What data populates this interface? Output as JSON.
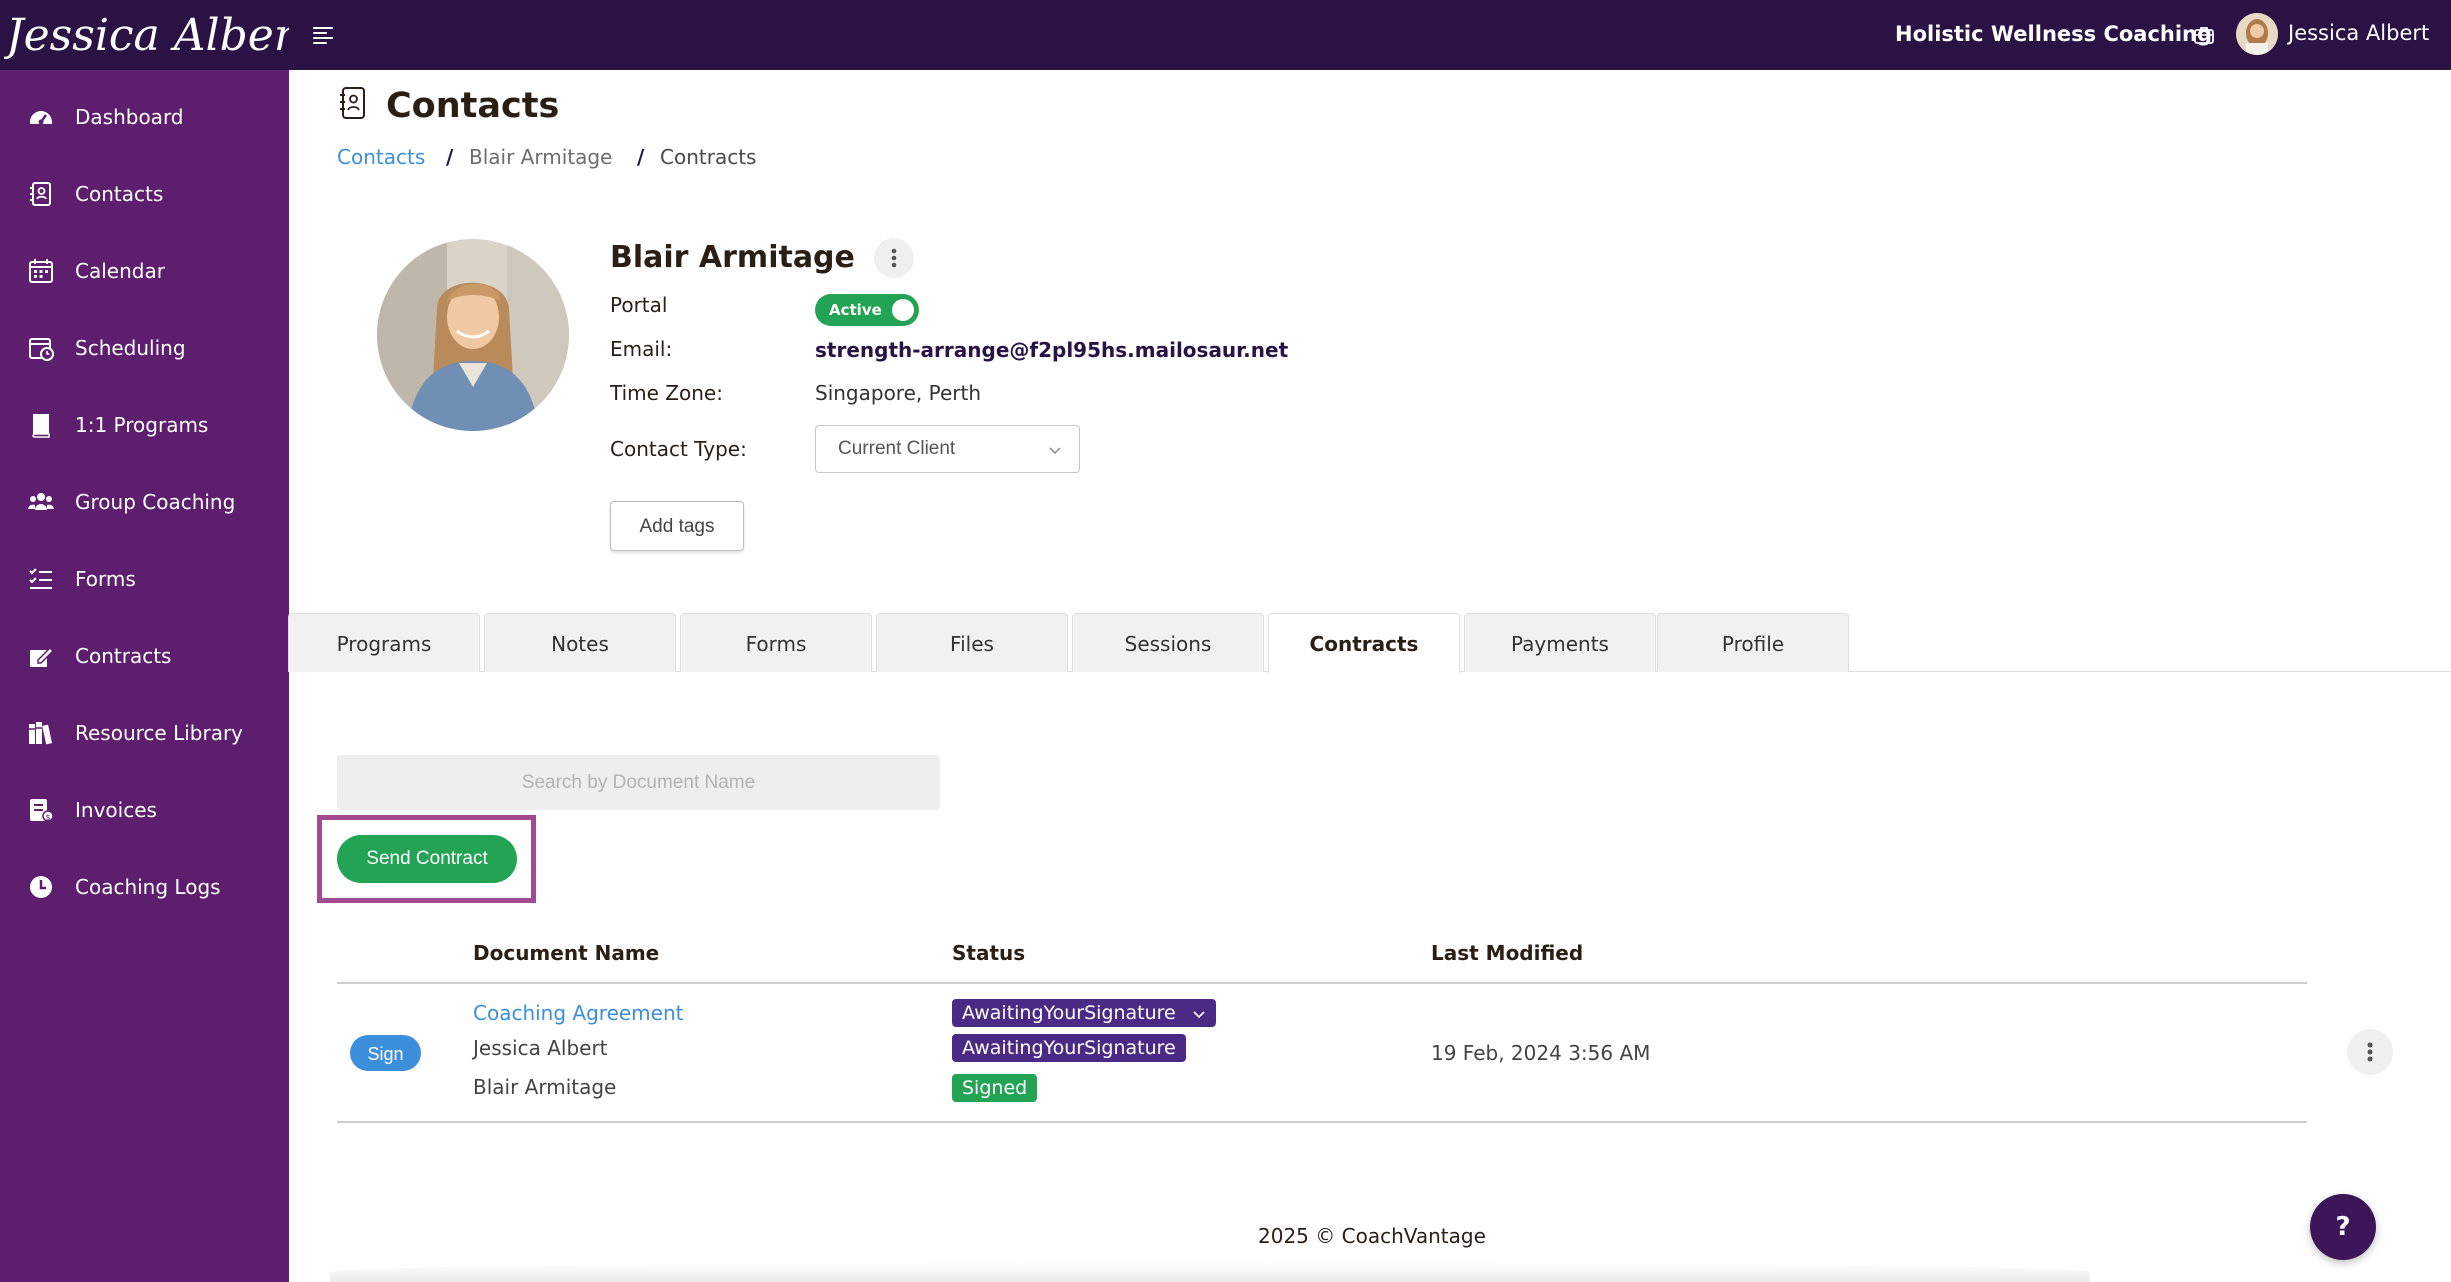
{
  "topbar": {
    "logo_text": "Jessica Albert",
    "business_name": "Holistic Wellness Coaching",
    "user_name": "Jessica Albert"
  },
  "sidebar": {
    "items": [
      {
        "label": "Dashboard",
        "icon": "dashboard-gauge-icon"
      },
      {
        "label": "Contacts",
        "icon": "address-book-icon"
      },
      {
        "label": "Calendar",
        "icon": "calendar-icon"
      },
      {
        "label": "Scheduling",
        "icon": "calendar-clock-icon"
      },
      {
        "label": "1:1 Programs",
        "icon": "book-icon"
      },
      {
        "label": "Group Coaching",
        "icon": "users-icon"
      },
      {
        "label": "Forms",
        "icon": "checklist-icon"
      },
      {
        "label": "Contracts",
        "icon": "signature-icon"
      },
      {
        "label": "Resource Library",
        "icon": "library-icon"
      },
      {
        "label": "Invoices",
        "icon": "invoice-icon"
      },
      {
        "label": "Coaching Logs",
        "icon": "clock-icon"
      }
    ]
  },
  "page": {
    "title": "Contacts",
    "breadcrumb": [
      "Contacts",
      "Blair Armitage",
      "Contracts"
    ],
    "breadcrumb_separator": "/"
  },
  "contact": {
    "name": "Blair Armitage",
    "portal_label": "Portal",
    "portal_status": "Active",
    "email_label": "Email:",
    "email": "strength-arrange@f2pl95hs.mailosaur.net",
    "timezone_label": "Time Zone:",
    "timezone": "Singapore, Perth",
    "contact_type_label": "Contact Type:",
    "contact_type": "Current Client",
    "add_tags_label": "Add tags"
  },
  "tabs": [
    {
      "label": "Programs",
      "active": false
    },
    {
      "label": "Notes",
      "active": false
    },
    {
      "label": "Forms",
      "active": false
    },
    {
      "label": "Files",
      "active": false
    },
    {
      "label": "Sessions",
      "active": false
    },
    {
      "label": "Contracts",
      "active": true
    },
    {
      "label": "Payments",
      "active": false
    },
    {
      "label": "Profile",
      "active": false
    }
  ],
  "contracts": {
    "search_placeholder": "Search by Document Name",
    "send_button": "Send Contract",
    "columns": [
      "Document Name",
      "Status",
      "Last Modified"
    ],
    "rows": [
      {
        "action": "Sign",
        "document": "Coaching Agreement",
        "signers": [
          "Jessica Albert",
          "Blair Armitage"
        ],
        "overall_status": "AwaitingYourSignature",
        "signer_statuses": [
          "AwaitingYourSignature",
          "Signed"
        ],
        "last_modified": "19 Feb, 2024 3:56 AM"
      }
    ]
  },
  "footer": {
    "text": "2025 © CoachVantage"
  },
  "help": {
    "label": "?"
  },
  "colors": {
    "topbar": "#2a1245",
    "sidebar": "#5d1e6e",
    "success": "#23a455",
    "link": "#3c8fdb",
    "status_purple": "#4b2a86",
    "highlight": "#a24a8f"
  }
}
